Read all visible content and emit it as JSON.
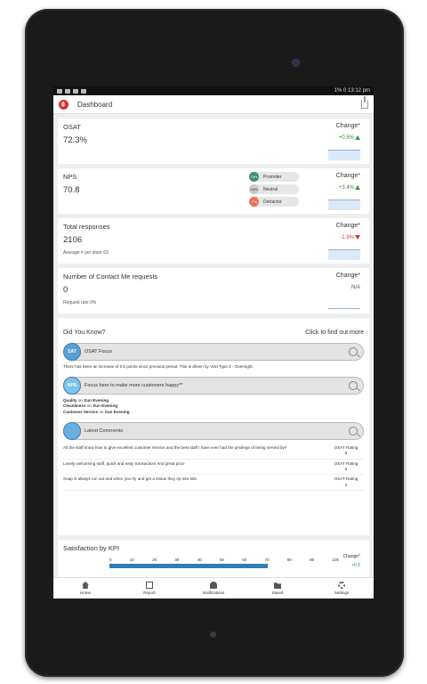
{
  "status": {
    "right": "1% 0 13:12 pm"
  },
  "appbar": {
    "title": "Dashboard"
  },
  "metrics": {
    "osat": {
      "title": "OSAT",
      "value": "72.3%",
      "change_label": "Change*",
      "change": "+0.5%"
    },
    "nps": {
      "title": "NPS",
      "value": "70.8",
      "change_label": "Change*",
      "change": "+3.4%",
      "legend": [
        {
          "pct": "78%",
          "label": "Promoter",
          "color": "#3f8f6e"
        },
        {
          "pct": "16%",
          "label": "Neutral",
          "color": "#c9c9c9"
        },
        {
          "pct": "7%",
          "label": "Detractor",
          "color": "#e8735b"
        }
      ]
    },
    "responses": {
      "title": "Total responses",
      "value": "2106",
      "sub": "Average # per store 63",
      "change_label": "Change*",
      "change": "-1.9%"
    },
    "contact": {
      "title": "Number of Contact Me requests",
      "value": "0",
      "sub": "Request rate 0%",
      "change_label": "Change*",
      "change": "N/A"
    }
  },
  "did_you_know": {
    "title": "Did You Know?",
    "cta": "Click to find out more",
    "osat_focus": {
      "label": "OSAT Focus",
      "icon_text": "SAT",
      "text": "There has been an increase of 0.5 points since previous period. This is driven by Visit Type 2 - Overnight."
    },
    "focus_happy": {
      "label": "Focus here to make more customers happy**",
      "icon_text": "NPS",
      "lines": [
        {
          "kpi": "Quality",
          "on": "on",
          "when": "Sun Evening"
        },
        {
          "kpi": "Cleanliness",
          "on": "on",
          "when": "Sun Evening"
        },
        {
          "kpi": "Customer Service",
          "on": "on",
          "when": "Sun Evening"
        }
      ]
    },
    "latest_comments": {
      "label": "Latest Comments",
      "items": [
        {
          "text": "All the staff know how to give excellent customer service and the best staff I have ever had the privilege of being served by!!",
          "rating_label": "OSAT Rating",
          "rating": "5"
        },
        {
          "text": "Lovely welcoming staff, quick and easy transaction! And great price",
          "rating_label": "OSAT Rating",
          "rating": "5"
        },
        {
          "text": "Soap is always run out and when you try and get a tissue they rip into bits.",
          "rating_label": "OSAT Rating",
          "rating": "2"
        }
      ]
    }
  },
  "kpi": {
    "title": "Satisfaction by KPI",
    "ticks": [
      "0",
      "10",
      "20",
      "30",
      "40",
      "50",
      "60",
      "70",
      "80",
      "90",
      "100"
    ],
    "change_label": "Change*",
    "change": "+0.5"
  },
  "nav": [
    {
      "label": "Home",
      "icon": "home-icon"
    },
    {
      "label": "Report",
      "icon": "report-icon"
    },
    {
      "label": "Notifications",
      "icon": "bell-icon"
    },
    {
      "label": "Saved",
      "icon": "folder-icon"
    },
    {
      "label": "Settings",
      "icon": "gear-icon"
    }
  ]
}
